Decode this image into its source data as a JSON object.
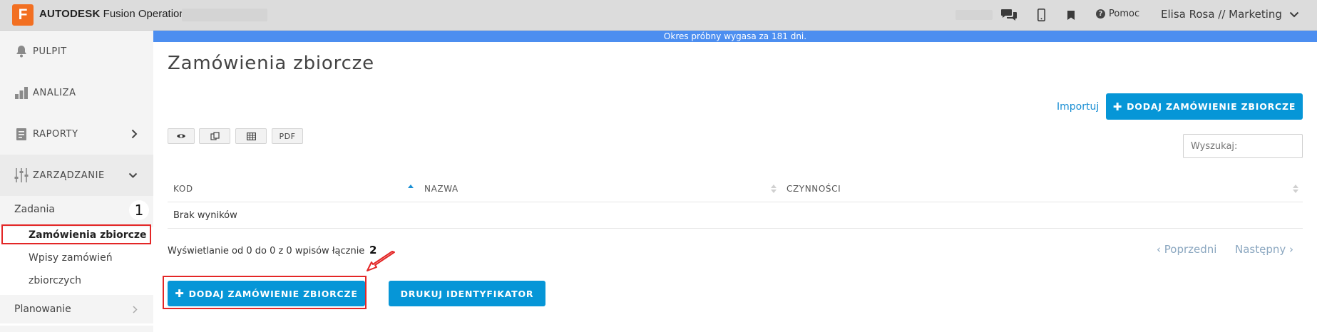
{
  "topbar": {
    "logo_letter": "F",
    "brand_bold": "AUTODESK",
    "brand_rest": "Fusion Operations",
    "icons": [
      "chat-icon",
      "mobile-icon",
      "bookmark-icon",
      "help-icon"
    ],
    "help_label": "Pomoc",
    "user_label": "Elisa Rosa // Marketing"
  },
  "sidebar": {
    "items": [
      {
        "label": "PULPIT",
        "icon": "bell-icon"
      },
      {
        "label": "ANALIZA",
        "icon": "bar-chart-icon"
      },
      {
        "label": "RAPORTY",
        "icon": "report-icon"
      },
      {
        "label": "ZARZĄDZANIE",
        "icon": "sliders-icon"
      }
    ],
    "sub_header": "Zadania",
    "sub_items": [
      "Zamówienia zbiorcze",
      "Wpisy zamówień",
      "zbiorczych"
    ],
    "planning_label": "Planowanie",
    "annotation_1": "1"
  },
  "main": {
    "trial_banner": "Okres próbny wygasa za 181 dni.",
    "page_title": "Zamówienia zbiorcze",
    "import_link": "Importuj",
    "add_button_top": "DODAJ ZAMÓWIENIE ZBIORCZE",
    "toolbar": {
      "pdf_label": "PDF"
    },
    "search_placeholder": "Wyszukaj:",
    "table": {
      "columns": [
        "KOD",
        "NAZWA",
        "CZYNNOŚCI"
      ],
      "empty_text": "Brak wyników"
    },
    "info_text": "Wyświetlanie od 0 do 0 z 0 wpisów łącznie",
    "pager": {
      "prev": "‹ Poprzedni",
      "next": "Następny ›"
    },
    "annotation_2": "2",
    "add_button_bottom": "DODAJ ZAMÓWIENIE ZBIORCZE",
    "print_button": "DRUKUJ IDENTYFIKATOR"
  },
  "colors": {
    "accent": "#0696d7",
    "trial_banner": "#4c8ef0",
    "logo": "#f26f21",
    "highlight": "#e32626"
  }
}
